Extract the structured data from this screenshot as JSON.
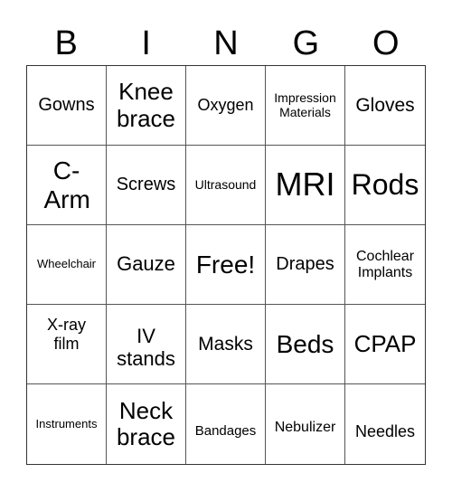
{
  "header": {
    "letters": [
      "B",
      "I",
      "N",
      "G",
      "O"
    ]
  },
  "cells": [
    "Gowns",
    "Knee brace",
    "Oxygen",
    "Impression Materials",
    "Gloves",
    "C-Arm",
    "Screws",
    "Ultrasound",
    "MRI",
    "Rods",
    "Wheelchair",
    "Gauze",
    "Free!",
    "Drapes",
    "Cochlear Implants",
    "X-ray film",
    "IV stands",
    "Masks",
    "Beds",
    "CPAP",
    "Instruments",
    "Neck brace",
    "Bandages",
    "Nebulizer",
    "Needles"
  ]
}
